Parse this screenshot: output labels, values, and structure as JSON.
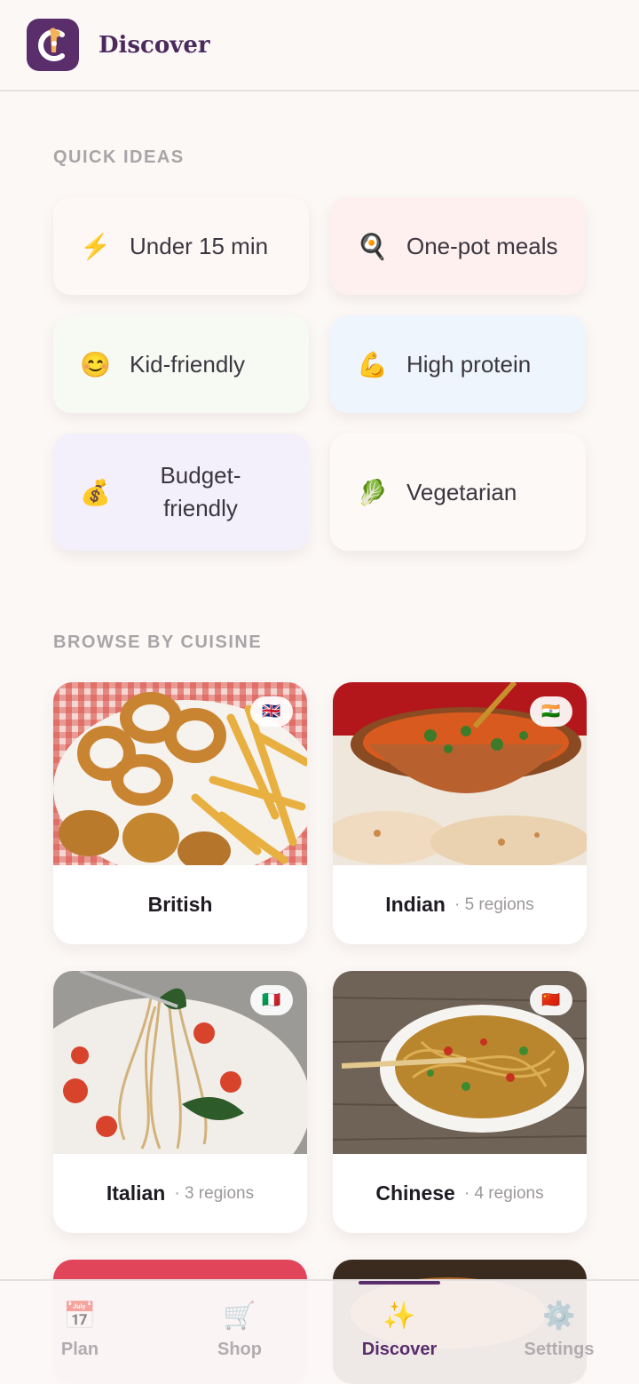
{
  "header": {
    "title": "Discover",
    "logo_icon": "chef-logo-icon"
  },
  "quick_ideas": {
    "heading": "QUICK IDEAS",
    "items": [
      {
        "emoji": "⚡",
        "icon": "lightning-icon",
        "label": "Under 15 min",
        "color": "#fdf8f6"
      },
      {
        "emoji": "🍳",
        "icon": "frying-pan-icon",
        "label": "One-pot meals",
        "color": "#fdf0ee"
      },
      {
        "emoji": "😊",
        "icon": "smile-icon",
        "label": "Kid-friendly",
        "color": "#f6faf3"
      },
      {
        "emoji": "💪",
        "icon": "flexed-arm-icon",
        "label": "High protein",
        "color": "#eef5fc"
      },
      {
        "emoji": "💰",
        "icon": "money-bag-icon",
        "label": "Budget-\nfriendly",
        "color": "#f3f0fc"
      },
      {
        "emoji": "🥬",
        "icon": "leafy-green-icon",
        "label": "Vegetarian",
        "color": "#fdf9f7"
      }
    ]
  },
  "cuisines": {
    "heading": "BROWSE BY CUISINE",
    "items": [
      {
        "name": "British",
        "regions": "",
        "flag": "🇬🇧",
        "image": "fish-and-chips-photo"
      },
      {
        "name": "Indian",
        "regions": "· 5 regions",
        "flag": "🇮🇳",
        "image": "curry-and-naan-photo"
      },
      {
        "name": "Italian",
        "regions": "· 3 regions",
        "flag": "🇮🇹",
        "image": "spaghetti-photo"
      },
      {
        "name": "Chinese",
        "regions": "· 4 regions",
        "flag": "🇨🇳",
        "image": "noodles-photo"
      }
    ]
  },
  "bottom_nav": {
    "items": [
      {
        "label": "Plan",
        "emoji": "📅",
        "icon": "calendar-icon"
      },
      {
        "label": "Shop",
        "emoji": "🛒",
        "icon": "cart-icon"
      },
      {
        "label": "Discover",
        "emoji": "✨",
        "icon": "sparkles-icon",
        "active": true
      },
      {
        "label": "Settings",
        "emoji": "⚙️",
        "icon": "gear-icon"
      }
    ]
  },
  "colors": {
    "brand": "#5a2d6b",
    "background": "#fcf8f6"
  }
}
